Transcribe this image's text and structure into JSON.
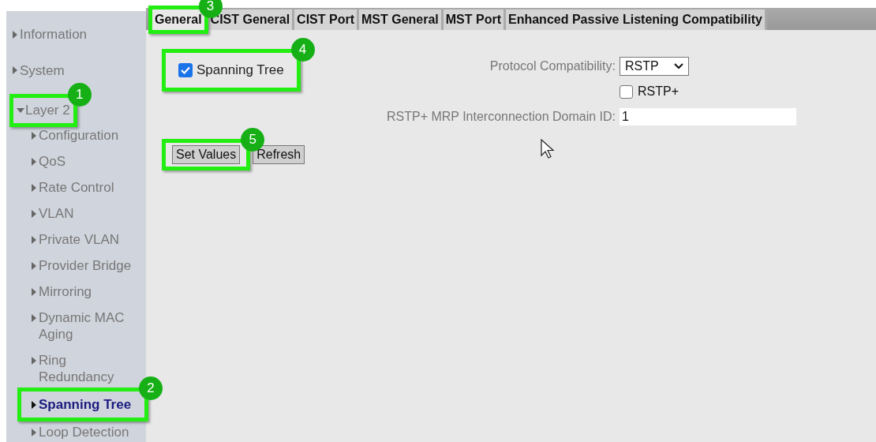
{
  "sidebar": {
    "items": [
      {
        "label": "Information",
        "expanded": false,
        "selected": false
      },
      {
        "label": "System",
        "expanded": false,
        "selected": false
      },
      {
        "label": "Layer 2",
        "expanded": true,
        "selected": false,
        "callout": "1",
        "children": [
          {
            "label": "Configuration",
            "selected": false
          },
          {
            "label": "QoS",
            "selected": false
          },
          {
            "label": "Rate Control",
            "selected": false
          },
          {
            "label": "VLAN",
            "selected": false
          },
          {
            "label": "Private VLAN",
            "selected": false
          },
          {
            "label": "Provider Bridge",
            "selected": false
          },
          {
            "label": "Mirroring",
            "selected": false
          },
          {
            "label": "Dynamic MAC Aging",
            "selected": false
          },
          {
            "label": "Ring Redundancy",
            "selected": false
          },
          {
            "label": "Spanning Tree",
            "selected": true,
            "callout": "2"
          },
          {
            "label": "Loop Detection",
            "selected": false
          }
        ]
      }
    ]
  },
  "tabs": [
    {
      "label": "General",
      "selected": true,
      "callout": "3"
    },
    {
      "label": "CIST General",
      "selected": false
    },
    {
      "label": "CIST Port",
      "selected": false
    },
    {
      "label": "MST General",
      "selected": false
    },
    {
      "label": "MST Port",
      "selected": false
    },
    {
      "label": "Enhanced Passive Listening Compatibility",
      "selected": false
    }
  ],
  "spanning_tree": {
    "label": "Spanning Tree",
    "checked": true,
    "callout": "4"
  },
  "protocol_compatibility": {
    "label": "Protocol Compatibility:",
    "value": "RSTP"
  },
  "rstp_plus": {
    "label": "RSTP+",
    "checked": false
  },
  "domain_id": {
    "label": "RSTP+ MRP Interconnection Domain ID:",
    "value": "1"
  },
  "buttons": [
    {
      "label": "Set Values",
      "callout": "5"
    },
    {
      "label": "Refresh"
    }
  ]
}
